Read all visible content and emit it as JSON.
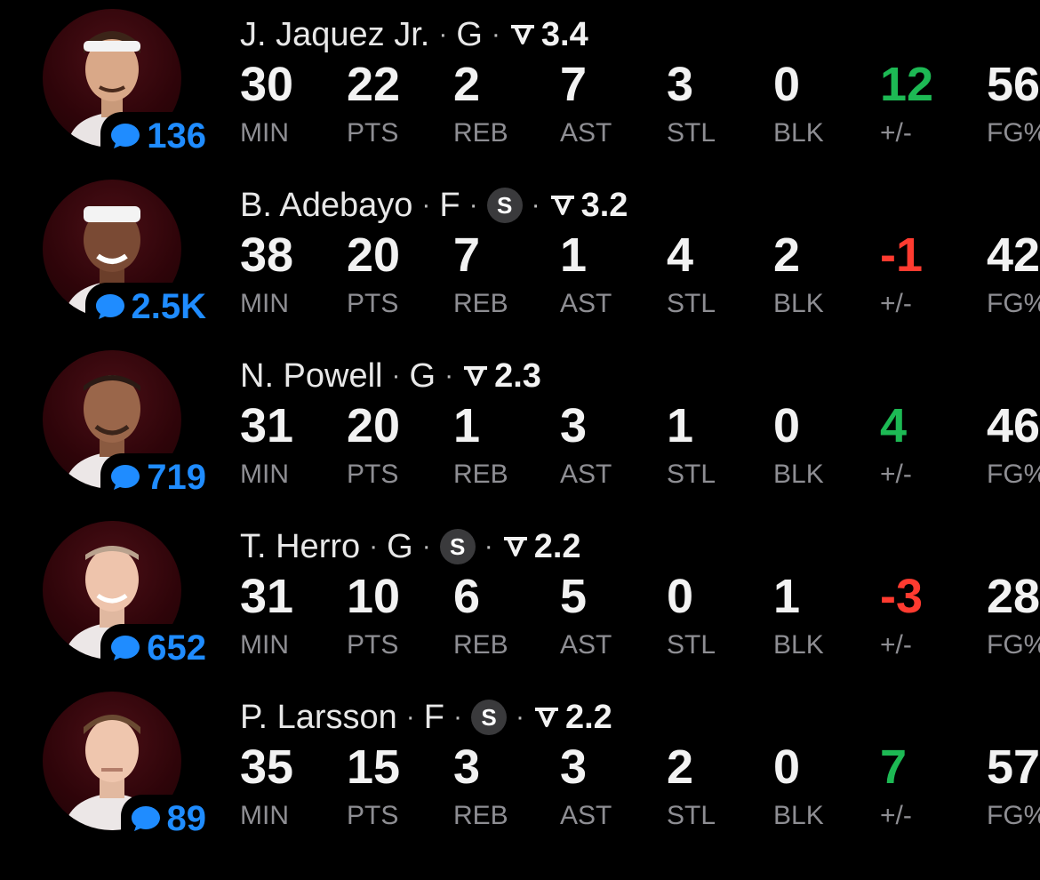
{
  "stat_labels": {
    "min": "MIN",
    "pts": "PTS",
    "reb": "REB",
    "ast": "AST",
    "stl": "STL",
    "blk": "BLK",
    "plus_minus": "+/-",
    "fg": "FG%"
  },
  "colors": {
    "accent": "#1f8cff",
    "positive": "#1db954",
    "negative": "#ff3b30",
    "avatar_bg": "#3a0910"
  },
  "icons": {
    "comment": "speech-bubble-icon",
    "rating": "rating-chevron-icon",
    "starter": "starter-badge"
  },
  "players": [
    {
      "name": "J. Jaquez Jr.",
      "position": "G",
      "starter": false,
      "rating": "3.4",
      "comments": "136",
      "min": "30",
      "pts": "22",
      "reb": "2",
      "ast": "7",
      "stl": "3",
      "blk": "0",
      "plus_minus": "12",
      "plus_minus_sign": "positive",
      "fg": "56"
    },
    {
      "name": "B. Adebayo",
      "position": "F",
      "starter": true,
      "starter_label": "S",
      "rating": "3.2",
      "comments": "2.5K",
      "min": "38",
      "pts": "20",
      "reb": "7",
      "ast": "1",
      "stl": "4",
      "blk": "2",
      "plus_minus": "-1",
      "plus_minus_sign": "negative",
      "fg": "42"
    },
    {
      "name": "N. Powell",
      "position": "G",
      "starter": false,
      "rating": "2.3",
      "comments": "719",
      "min": "31",
      "pts": "20",
      "reb": "1",
      "ast": "3",
      "stl": "1",
      "blk": "0",
      "plus_minus": "4",
      "plus_minus_sign": "positive",
      "fg": "46"
    },
    {
      "name": "T. Herro",
      "position": "G",
      "starter": true,
      "starter_label": "S",
      "rating": "2.2",
      "comments": "652",
      "min": "31",
      "pts": "10",
      "reb": "6",
      "ast": "5",
      "stl": "0",
      "blk": "1",
      "plus_minus": "-3",
      "plus_minus_sign": "negative",
      "fg": "28"
    },
    {
      "name": "P. Larsson",
      "position": "F",
      "starter": true,
      "starter_label": "S",
      "rating": "2.2",
      "comments": "89",
      "min": "35",
      "pts": "15",
      "reb": "3",
      "ast": "3",
      "stl": "2",
      "blk": "0",
      "plus_minus": "7",
      "plus_minus_sign": "positive",
      "fg": "57"
    }
  ]
}
